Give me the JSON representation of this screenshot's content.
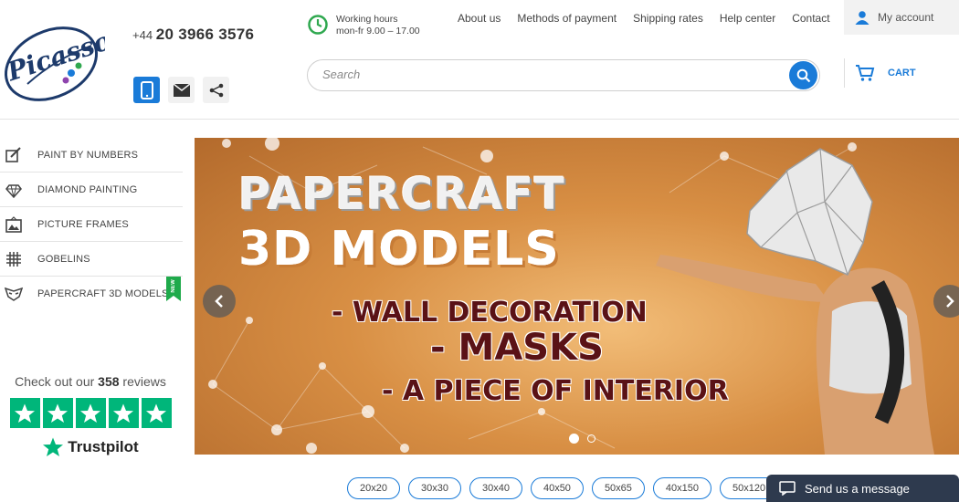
{
  "brand": {
    "logo_text": "Picasso"
  },
  "header": {
    "phone_prefix": "+44",
    "phone_number": "20 3966 3576",
    "hours_title": "Working hours",
    "hours_value": "mon-fr 9.00 – 17.00",
    "nav": [
      "About us",
      "Methods of payment",
      "Shipping rates",
      "Help center",
      "Contact"
    ],
    "account_label": "My account",
    "search_placeholder": "Search",
    "cart_label": "CART"
  },
  "sidebar": {
    "items": [
      {
        "label": "PAINT BY NUMBERS",
        "icon": "paint-brush-icon"
      },
      {
        "label": "DIAMOND PAINTING",
        "icon": "diamond-icon"
      },
      {
        "label": "PICTURE FRAMES",
        "icon": "frame-icon"
      },
      {
        "label": "GOBELINS",
        "icon": "grid-icon"
      },
      {
        "label": "PAPERCRAFT 3D MODELS",
        "icon": "mask-icon",
        "badge": "NEW"
      }
    ]
  },
  "reviews": {
    "prefix": "Check out our",
    "count": "358",
    "suffix": "reviews",
    "brand": "Trustpilot",
    "stars": 5
  },
  "banner": {
    "line1": "PAPERCRAFT",
    "line2": "3D MODELS",
    "line3": "- WALL DECORATION",
    "line4": "- MASKS",
    "line5": "- A PIECE OF INTERIOR",
    "slides_total": 2,
    "slide_active": 1
  },
  "sizes": [
    "20x20",
    "30x30",
    "30x40",
    "40x50",
    "50x65",
    "40x150",
    "50x120"
  ],
  "chat": {
    "label": "Send us a message"
  },
  "colors": {
    "accent": "#1a7bd8",
    "trustpilot": "#00b67a",
    "banner_text": "#5a1216"
  }
}
